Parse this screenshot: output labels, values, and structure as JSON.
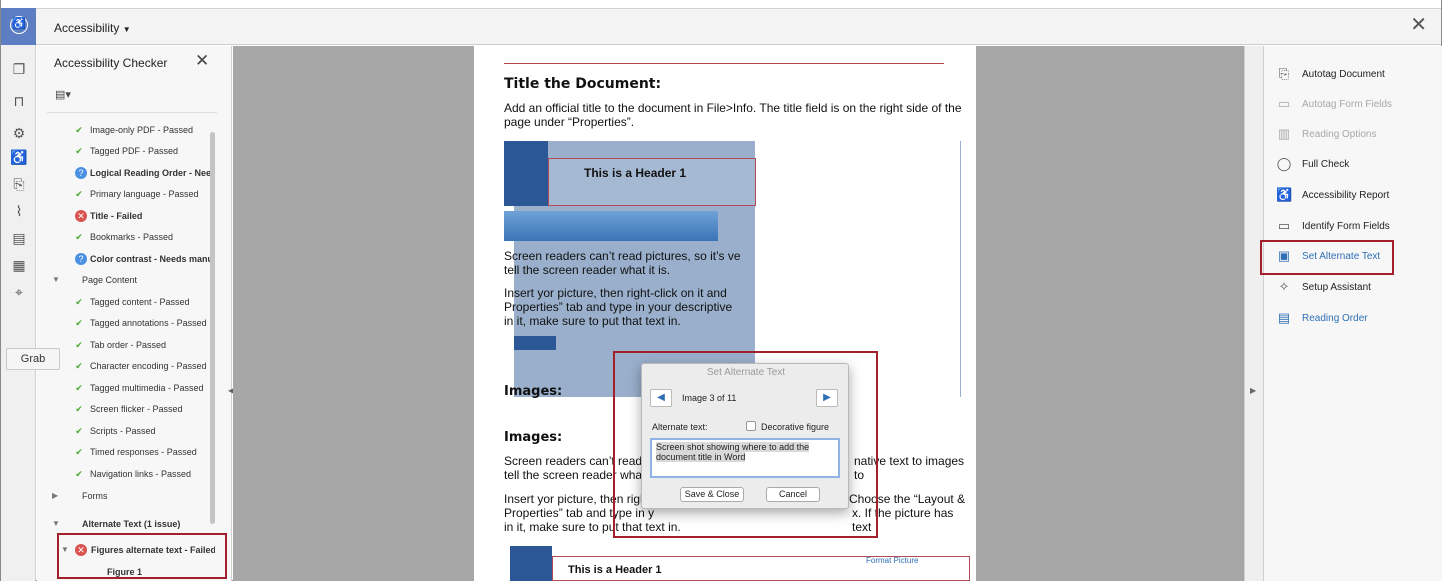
{
  "window": {
    "title": "Accessibility",
    "close_label": "✕"
  },
  "rail": {
    "grab_label": "Grab"
  },
  "checker": {
    "title": "Accessibility Checker",
    "close": "✕",
    "rows": [
      {
        "text": "Image-only PDF - Passed",
        "status": "ok",
        "bold": false
      },
      {
        "text": "Tagged PDF - Passed",
        "status": "ok",
        "bold": false
      },
      {
        "text": "Logical Reading Order - Needs manual check",
        "status": "q",
        "bold": true
      },
      {
        "text": "Primary language - Passed",
        "status": "ok",
        "bold": false
      },
      {
        "text": "Title - Failed",
        "status": "fail",
        "bold": true
      },
      {
        "text": "Bookmarks - Passed",
        "status": "ok",
        "bold": false
      },
      {
        "text": "Color contrast - Needs manual check",
        "status": "q",
        "bold": true
      },
      {
        "text": "Page Content",
        "status": "group",
        "bold": false
      },
      {
        "text": "Tagged content - Passed",
        "status": "ok",
        "bold": false
      },
      {
        "text": "Tagged annotations - Passed",
        "status": "ok",
        "bold": false
      },
      {
        "text": "Tab order - Passed",
        "status": "ok",
        "bold": false
      },
      {
        "text": "Character encoding - Passed",
        "status": "ok",
        "bold": false
      },
      {
        "text": "Tagged multimedia - Passed",
        "status": "ok",
        "bold": false
      },
      {
        "text": "Screen flicker - Passed",
        "status": "ok",
        "bold": false
      },
      {
        "text": "Scripts - Passed",
        "status": "ok",
        "bold": false
      },
      {
        "text": "Timed responses - Passed",
        "status": "ok",
        "bold": false
      },
      {
        "text": "Navigation links - Passed",
        "status": "ok",
        "bold": false
      },
      {
        "text": "Forms",
        "status": "group-collapsed",
        "bold": false
      },
      {
        "text": "Alternate Text (1 issue)",
        "status": "group",
        "bold": true
      },
      {
        "text": "Figures alternate text - Failed",
        "status": "fail",
        "bold": true
      },
      {
        "text": "Figure 1",
        "status": "leaf",
        "bold": true
      }
    ]
  },
  "document": {
    "heading1": "Title the Document:",
    "para1": "Add an official title to the document in File>Info. The title field is on the right side of the page under “Properties”.",
    "embedded_header": "This is a Header 1",
    "para2": "Screen readers can’t read pictures, so it’s ve",
    "para2b": "tell the screen reader what it is.",
    "para3a": "Insert yor picture, then right-click on it and",
    "para3b": "Properties” tab and type in your descriptive",
    "para3c": "in it, make sure to put that text in.",
    "heading_images1": "Images:",
    "heading_images2": "Images:",
    "para4a": "Screen readers can’t read pi",
    "para4a_r": "native text to images to",
    "para4b": "tell the screen reader what",
    "para5a": "Insert yor picture, then righ",
    "para5a_r": "Choose the “Layout &",
    "para5b": "Properties” tab and type in y",
    "para5b_r": "x. If the picture has text",
    "para5c": "in it, make sure to put that text in.",
    "embedded_header2": "This is a Header 1",
    "format_picture": "Format Picture"
  },
  "dialog": {
    "title": "Set Alternate Text",
    "counter": "Image 3 of 11",
    "alt_label": "Alternate text:",
    "decorative_label": "Decorative figure",
    "alt_value": "Screen shot showing where to add the document title in Word",
    "save_label": "Save & Close",
    "cancel_label": "Cancel"
  },
  "tools": {
    "items": [
      {
        "label": "Autotag Document",
        "state": "normal",
        "icon": "autotag-icon"
      },
      {
        "label": "Autotag Form Fields",
        "state": "dim",
        "icon": "form-fields-icon"
      },
      {
        "label": "Reading Options",
        "state": "dim",
        "icon": "reading-options-icon"
      },
      {
        "label": "Full Check",
        "state": "normal",
        "icon": "check-circle-icon"
      },
      {
        "label": "Accessibility Report",
        "state": "normal",
        "icon": "accessibility-icon"
      },
      {
        "label": "Identify Form Fields",
        "state": "normal",
        "icon": "identify-fields-icon"
      },
      {
        "label": "Set Alternate Text",
        "state": "blue",
        "icon": "alt-text-icon"
      },
      {
        "label": "Setup Assistant",
        "state": "normal",
        "icon": "wand-icon"
      },
      {
        "label": "Reading Order",
        "state": "blue",
        "icon": "reading-order-icon"
      }
    ]
  },
  "colors": {
    "accent": "#2f6fb6",
    "highlight": "#a2202c",
    "rail": "#5d7ec2"
  }
}
